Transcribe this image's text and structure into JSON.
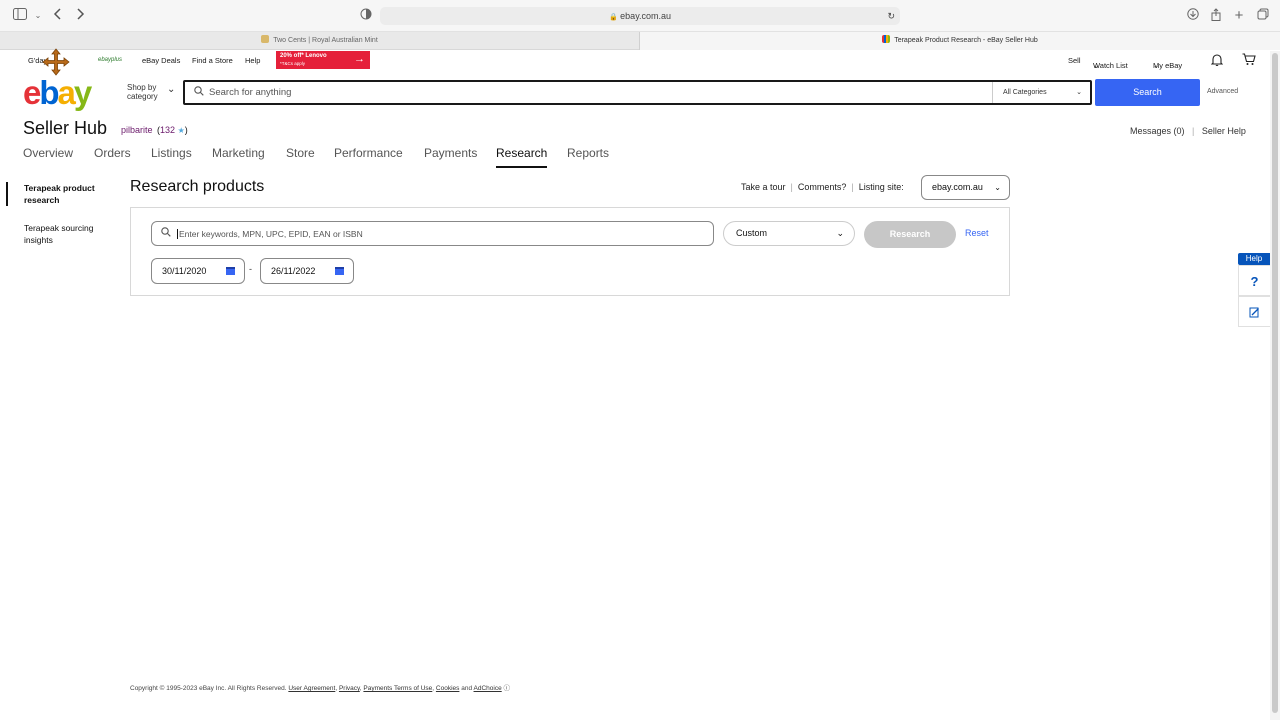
{
  "browser": {
    "url": "ebay.com.au",
    "tabs": [
      {
        "title": "Two Cents | Royal Australian Mint"
      },
      {
        "title": "Terapeak Product Research - eBay Seller Hub"
      }
    ]
  },
  "topnav": {
    "greeting": "G'day",
    "ebayplus_logo": "ebayplus",
    "deals": "eBay Deals",
    "find_store": "Find a Store",
    "help": "Help",
    "promo_line1": "20% off* Lenovo",
    "promo_line2": "*T&Cs apply",
    "sell": "Sell",
    "watchlist": "Watch List",
    "myebay": "My eBay"
  },
  "header": {
    "logo_letters": [
      "e",
      "b",
      "a",
      "y"
    ],
    "logo_colors": [
      "#e53238",
      "#0064d2",
      "#f5af02",
      "#86b817"
    ],
    "shop_by_line1": "Shop by",
    "shop_by_line2": "category",
    "search_placeholder": "Search for anything",
    "category_select": "All Categories",
    "search_button": "Search",
    "advanced": "Advanced"
  },
  "hub": {
    "title": "Seller Hub",
    "username": "pilbarite",
    "feedback_open": "(",
    "feedback_score": "132",
    "feedback_close": ")",
    "messages": "Messages (0)",
    "separator": "|",
    "seller_help": "Seller Help"
  },
  "mainnav": [
    {
      "label": "Overview"
    },
    {
      "label": "Orders"
    },
    {
      "label": "Listings"
    },
    {
      "label": "Marketing"
    },
    {
      "label": "Store"
    },
    {
      "label": "Performance"
    },
    {
      "label": "Payments"
    },
    {
      "label": "Research"
    },
    {
      "label": "Reports"
    }
  ],
  "sidebar": [
    {
      "label": "Terapeak product research"
    },
    {
      "label": "Terapeak sourcing insights"
    }
  ],
  "research": {
    "title": "Research products",
    "take_tour": "Take a tour",
    "comments": "Comments?",
    "listing_site_label": "Listing site:",
    "listing_site_value": "ebay.com.au",
    "sep": "|",
    "keyword_placeholder": "Enter keywords, MPN, UPC, EPID, EAN or ISBN",
    "range_value": "Custom",
    "research_button": "Research",
    "reset": "Reset",
    "date_from": "30/11/2020",
    "date_dash": "-",
    "date_to": "26/11/2022"
  },
  "help_widget": {
    "label": "Help",
    "question": "?"
  },
  "footer": {
    "copyright": "Copyright © 1995-2023 eBay Inc. All Rights Reserved.",
    "user_agreement": "User Agreement",
    "privacy": "Privacy",
    "payments_terms": "Payments Terms of Use",
    "cookies": "Cookies",
    "and": "and",
    "adchoice": "AdChoice"
  },
  "icons": {
    "sidebar_toggle": "sidebar-icon",
    "back": "chevron-left-icon",
    "forward": "chevron-right-icon",
    "download": "download-icon",
    "share": "share-icon",
    "new_tab": "plus-icon",
    "tabs_overview": "tabs-icon",
    "bell": "bell-icon",
    "cart": "cart-icon",
    "calendar": "calendar-icon"
  }
}
